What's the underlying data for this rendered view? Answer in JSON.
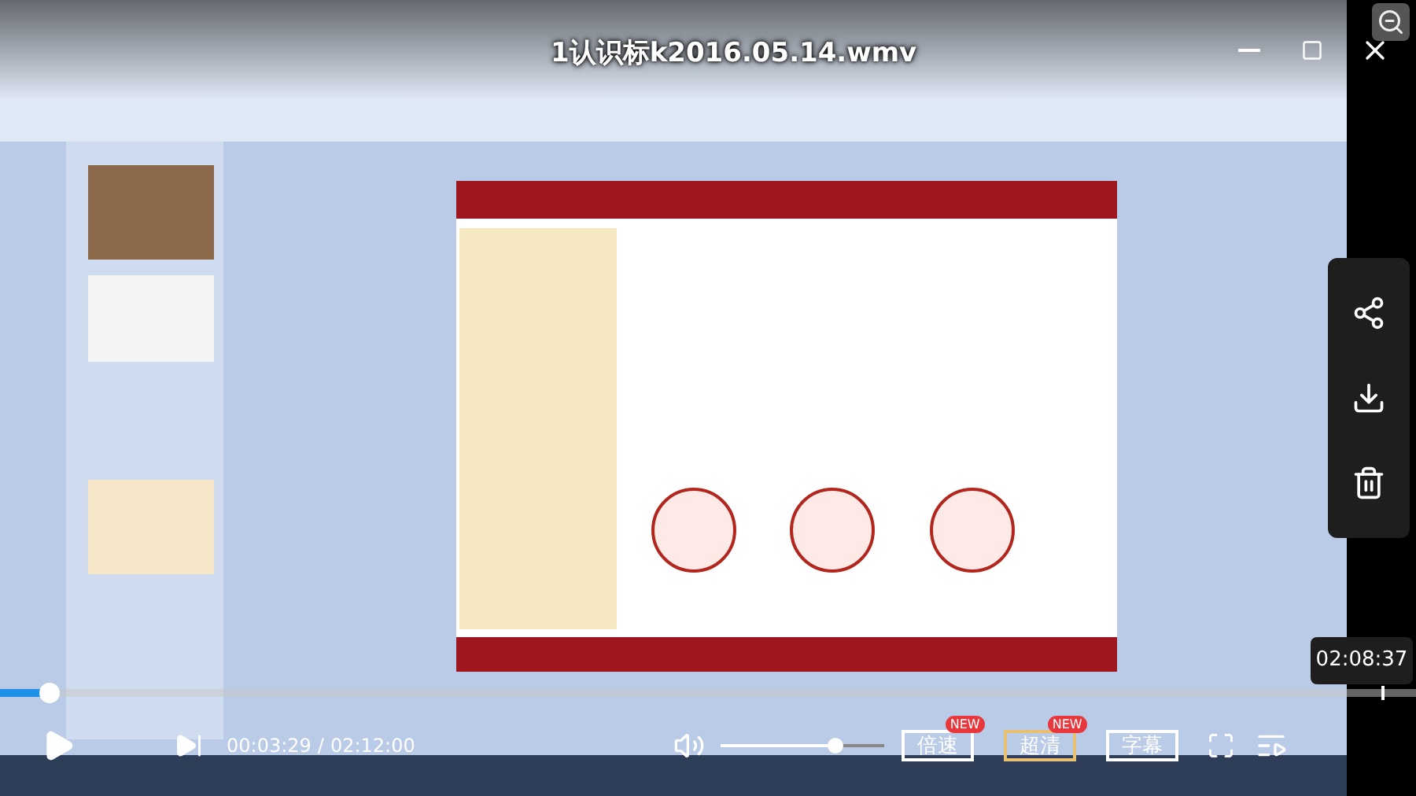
{
  "title": "1认识标k2016.05.14.wmv",
  "side_actions": [
    {
      "kind": "share"
    },
    {
      "kind": "download"
    },
    {
      "kind": "delete"
    }
  ],
  "hover_time": "02:08:37",
  "progress": {
    "level": 0.034
  },
  "controls": {
    "current_time": "00:03:29",
    "separator": "/",
    "duration": "02:12:00",
    "volume": {
      "level": 0.7
    }
  },
  "buttons": [
    {
      "label": "倍速",
      "badge": "NEW",
      "active": false
    },
    {
      "label": "超清",
      "badge": "NEW",
      "active": true
    },
    {
      "label": "字幕",
      "active": false
    }
  ]
}
